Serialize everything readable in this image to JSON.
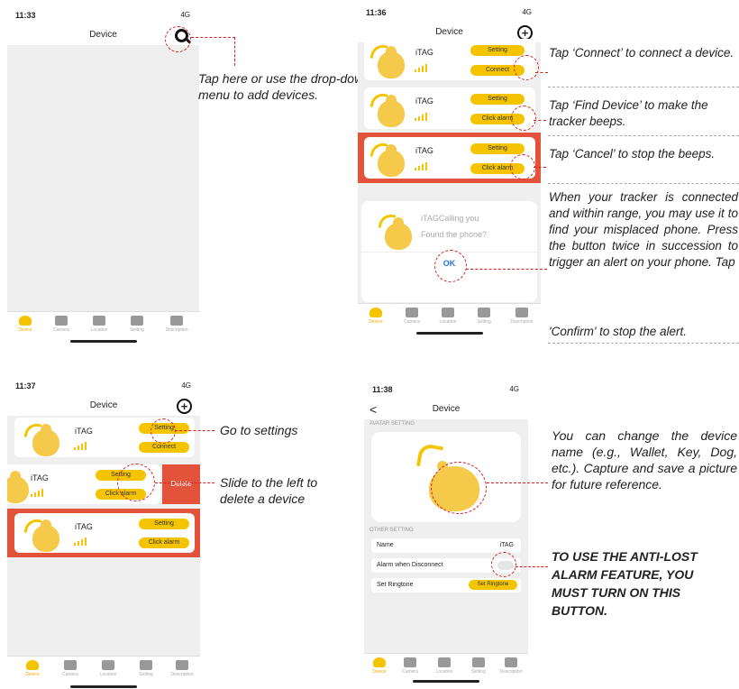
{
  "panel1": {
    "time": "11:33",
    "signal": "4G",
    "nav_title": "Device",
    "note": "Tap here or use the drop-down menu to add devices.",
    "tabs": [
      "Device",
      "Camera",
      "Location",
      "Setting",
      "Description"
    ]
  },
  "panel2": {
    "time": "11:36",
    "signal": "4G",
    "nav_title": "Device",
    "devices": [
      {
        "name": "iTAG",
        "btn_top": "Setting",
        "btn_bottom": "Connect"
      },
      {
        "name": "iTAG",
        "btn_top": "Setting",
        "btn_bottom": "Click alarm"
      },
      {
        "name": "iTAG",
        "btn_top": "Setting",
        "btn_bottom": "Click alarm"
      }
    ],
    "dialog": {
      "line1": "iTAGCalling you",
      "line2": "Found the phone?",
      "ok": "OK"
    },
    "notes": [
      "Tap ‘Connect’ to connect a device.",
      "Tap ‘Find Device’ to make the tracker beeps.",
      "Tap ‘Cancel’ to stop the beeps.",
      "When your tracker is connected and within range, you may use it to find your misplaced phone. Press the button twice in succession to trigger an alert on your phone. Tap",
      "'Confirm' to stop the alert."
    ],
    "tabs": [
      "Device",
      "Camera",
      "Location",
      "Setting",
      "Description"
    ]
  },
  "panel3": {
    "time": "11:37",
    "signal": "4G",
    "nav_title": "Device",
    "devices": [
      {
        "name": "iTAG",
        "btn_top": "Setting",
        "btn_bottom": "Connect"
      },
      {
        "name": "iTAG",
        "btn_top": "Setting",
        "btn_bottom": "Click alarm"
      },
      {
        "name": "iTAG",
        "btn_top": "Setting",
        "btn_bottom": "Click alarm"
      }
    ],
    "delete_label": "Delete",
    "notes": [
      "Go to settings",
      "Slide to the left to delete a device"
    ],
    "tabs": [
      "Device",
      "Camera",
      "Location",
      "Setting",
      "Description"
    ]
  },
  "panel4": {
    "time": "11:38",
    "signal": "4G",
    "nav_title": "Device",
    "avatar_section": "AVATAR SETTING",
    "other_section": "OTHER SETTING",
    "rows": [
      {
        "label": "Name",
        "value": "iTAG"
      },
      {
        "label": "Alarm when Disconnect",
        "value": ""
      },
      {
        "label": "Set Ringtone",
        "value": "Set Ringtone"
      }
    ],
    "notes": [
      "You can change the device name (e.g., Wallet, Key, Dog, etc.). Capture and save a picture for future reference.",
      "TO USE THE ANTI-LOST ALARM FEATURE, YOU MUST TURN ON THIS BUTTON."
    ],
    "tabs": [
      "Device",
      "Camera",
      "Location",
      "Setting",
      "Description"
    ]
  },
  "colors": {
    "accent": "#f5c400",
    "highlight": "#e3533c",
    "annotation": "#d62020"
  }
}
